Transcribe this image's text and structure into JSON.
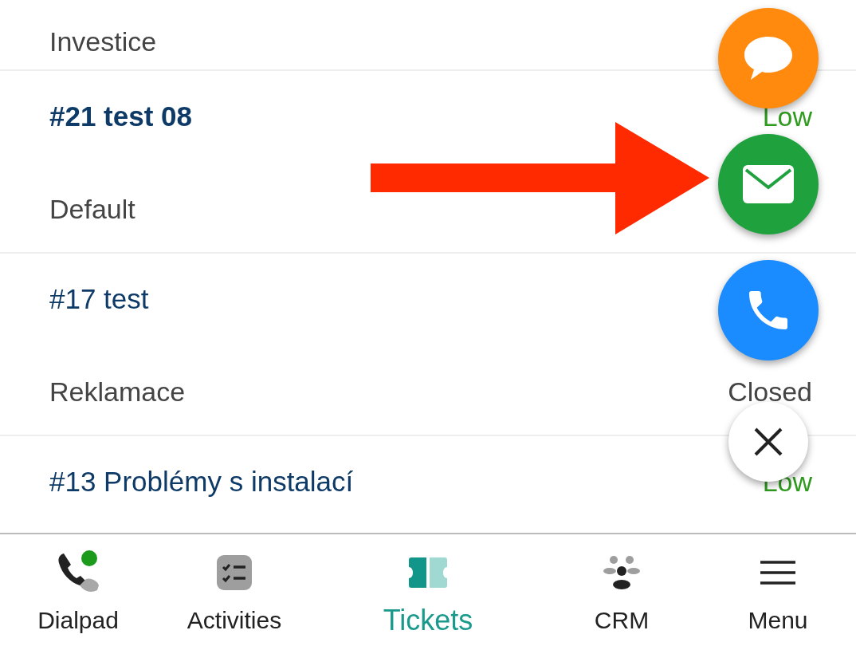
{
  "tickets": [
    {
      "category": "Investice"
    },
    {
      "title": "#21 test 08",
      "unread": true,
      "category": "Default",
      "priority": "Low"
    },
    {
      "title": "#17 test",
      "unread": false,
      "category": "Reklamace",
      "status": "Closed"
    },
    {
      "title": "#13 Problémy s instalací",
      "unread": false,
      "priority": "Low"
    }
  ],
  "fab_actions": [
    {
      "kind": "chat"
    },
    {
      "kind": "email"
    },
    {
      "kind": "phone"
    },
    {
      "kind": "close"
    }
  ],
  "nav": [
    {
      "label": "Dialpad",
      "kind": "dialpad",
      "selected": false
    },
    {
      "label": "Activities",
      "kind": "activities",
      "selected": false
    },
    {
      "label": "Tickets",
      "kind": "tickets",
      "selected": true
    },
    {
      "label": "CRM",
      "kind": "crm",
      "selected": false
    },
    {
      "label": "Menu",
      "kind": "menu",
      "selected": false
    }
  ]
}
